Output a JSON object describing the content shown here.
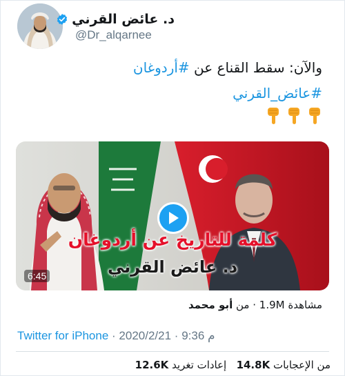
{
  "user": {
    "display_name": "د. عائض القرني",
    "handle": "@Dr_alqarnee",
    "verified": true,
    "avatar_icon": "profile-avatar"
  },
  "tweet": {
    "line1_text": "والآن: سقط القناع عن",
    "line1_hashtag": "#أردوغان",
    "line2_hashtag": "#عائض_القرني",
    "emoji_icons": [
      "backhand-index-pointing-down-icon",
      "backhand-index-pointing-down-icon",
      "backhand-index-pointing-down-icon"
    ]
  },
  "video": {
    "caption_line1": "كلمة للتاريخ عن أردوغان",
    "caption_line2": "د. عائض القرني",
    "duration": "6:45",
    "play_icon": "play-icon"
  },
  "meta": {
    "views": "مشاهدة 1.9M",
    "from_label": "· من",
    "author": "أبو محمد",
    "source": "Twitter for iPhone",
    "dot": "·",
    "date": "2020/2/21",
    "time": "9:36 م"
  },
  "stats": {
    "retweets_count": "12.6K",
    "retweets_label": "إعادات تغريد",
    "likes_count": "14.8K",
    "likes_label": "من الإعجابات"
  },
  "colors": {
    "link": "#1b95e0",
    "verified": "#1da1f2",
    "caption_red": "#e5102a"
  }
}
